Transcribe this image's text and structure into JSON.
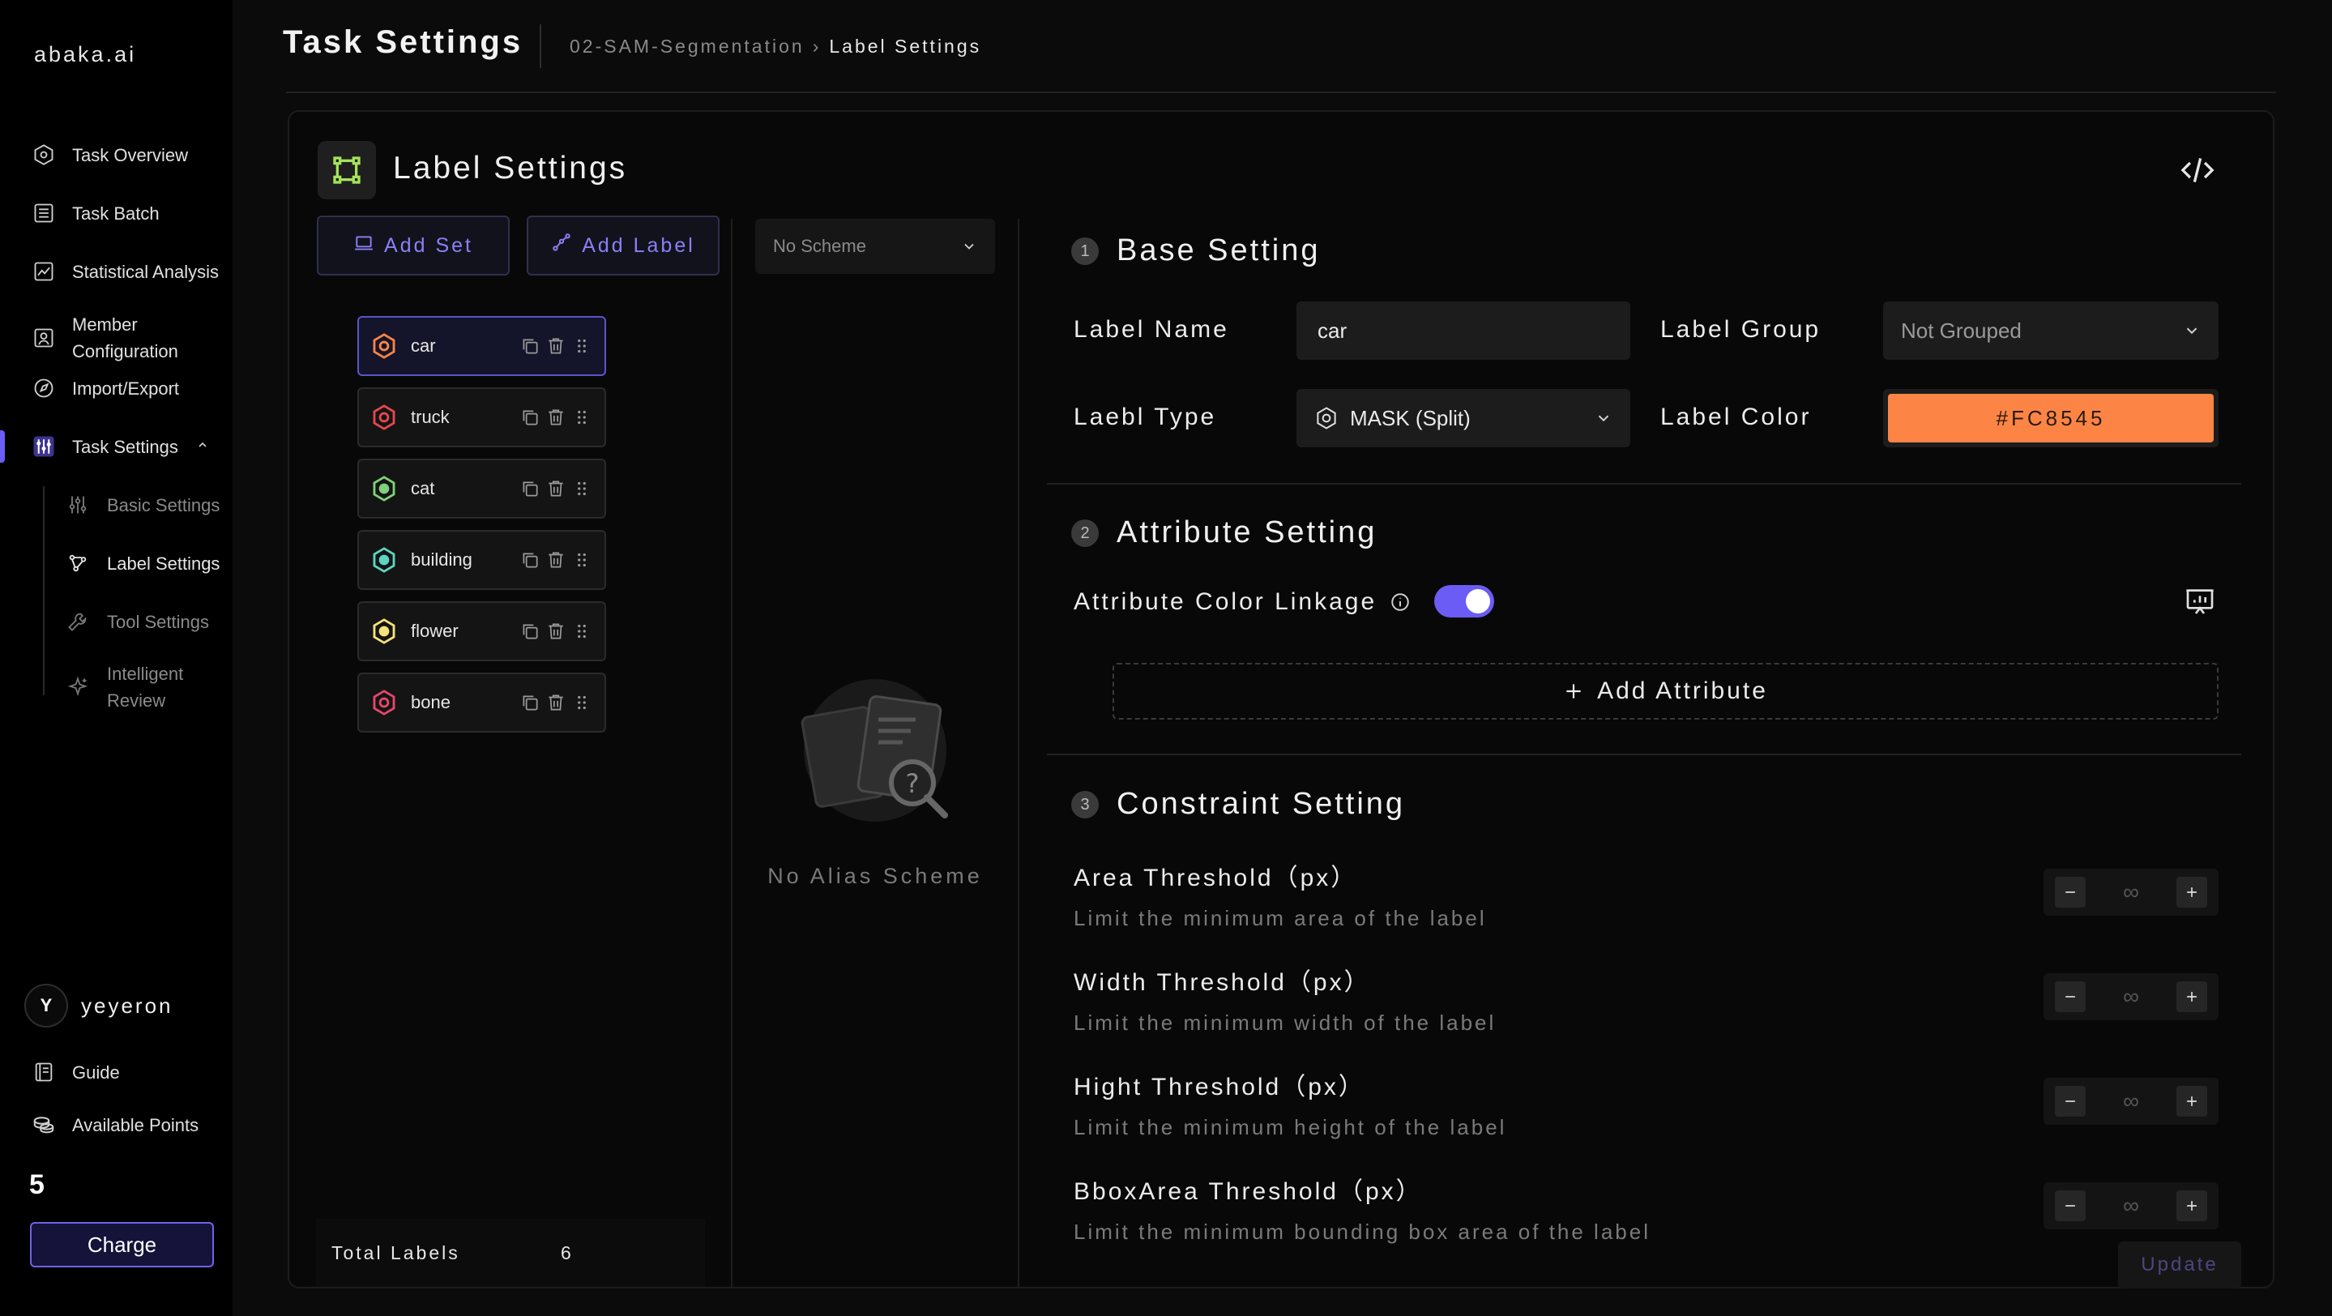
{
  "brand": "abaka.ai",
  "sidebar": {
    "items": [
      {
        "label": "Task Overview",
        "icon": "cube-icon"
      },
      {
        "label": "Task Batch",
        "icon": "list-icon"
      },
      {
        "label": "Statistical Analysis",
        "icon": "chart-icon"
      },
      {
        "label": "Member Configuration",
        "icon": "member-icon"
      },
      {
        "label": "Import/Export",
        "icon": "compass-icon"
      },
      {
        "label": "Task Settings",
        "icon": "settings-icon",
        "expanded": true
      }
    ],
    "sub_items": [
      {
        "label": "Basic Settings",
        "icon": "sliders-icon"
      },
      {
        "label": "Label Settings",
        "icon": "label-icon",
        "active": true
      },
      {
        "label": "Tool Settings",
        "icon": "wrench-icon"
      },
      {
        "label": "Intelligent Review",
        "icon": "sparkle-icon"
      }
    ],
    "user": {
      "initial": "Y",
      "name": "yeyeron"
    },
    "guide": "Guide",
    "available_points_label": "Available Points",
    "points": "5",
    "charge": "Charge"
  },
  "header": {
    "title": "Task Settings",
    "breadcrumb": [
      "02-SAM-Segmentation",
      "Label Settings"
    ],
    "breadcrumb_sep": "›"
  },
  "panel": {
    "title": "Label Settings",
    "add_set": "Add Set",
    "add_label": "Add Label",
    "scheme_placeholder": "No Scheme",
    "empty_text": "No Alias Scheme",
    "total_label": "Total Labels",
    "total_value": "6",
    "labels": [
      {
        "name": "car",
        "color": "#FC8545",
        "selected": true
      },
      {
        "name": "truck",
        "color": "#E5484D"
      },
      {
        "name": "cat",
        "color": "#7FD17A"
      },
      {
        "name": "building",
        "color": "#5FD4C0"
      },
      {
        "name": "flower",
        "color": "#F5E27A"
      },
      {
        "name": "bone",
        "color": "#E5486A"
      }
    ]
  },
  "base": {
    "num": "1",
    "title": "Base Setting",
    "name_label": "Label Name",
    "name_value": "car",
    "group_label": "Label Group",
    "group_value": "Not Grouped",
    "type_label": "Laebl Type",
    "type_value": "MASK (Split)",
    "color_label": "Label Color",
    "color_value": "#FC8545"
  },
  "attribute": {
    "num": "2",
    "title": "Attribute Setting",
    "linkage_label": "Attribute Color Linkage",
    "linkage_on": true,
    "add": "Add Attribute"
  },
  "constraint": {
    "num": "3",
    "title": "Constraint Setting",
    "items": [
      {
        "name": "Area Threshold（px）",
        "desc": "Limit the minimum area of the label",
        "value": "∞"
      },
      {
        "name": "Width Threshold（px）",
        "desc": "Limit the minimum width of the label",
        "value": "∞"
      },
      {
        "name": "Hight Threshold（px）",
        "desc": "Limit the minimum height of the label",
        "value": "∞"
      },
      {
        "name": "BboxArea Threshold（px）",
        "desc": "Limit the minimum bounding box area of the label",
        "value": "∞"
      }
    ],
    "update": "Update"
  }
}
